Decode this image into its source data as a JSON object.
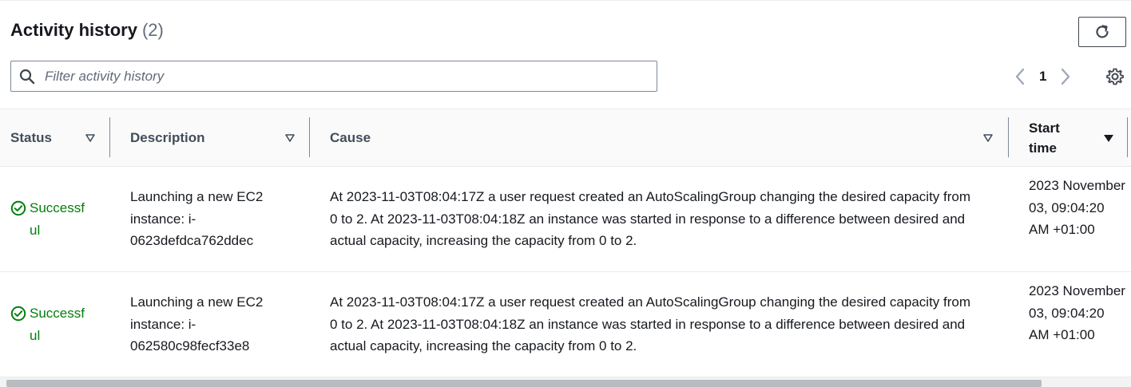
{
  "header": {
    "title": "Activity history",
    "count": "(2)",
    "refresh_icon": "refresh-icon"
  },
  "search": {
    "placeholder": "Filter activity history",
    "value": "",
    "icon": "search-icon"
  },
  "pagination": {
    "current_page": "1",
    "prev_icon": "chevron-left-icon",
    "next_icon": "chevron-right-icon",
    "settings_icon": "gear-icon"
  },
  "columns": {
    "status": "Status",
    "description": "Description",
    "cause": "Cause",
    "start_time": "Start time"
  },
  "rows": [
    {
      "status": "Successful",
      "description": "Launching a new EC2 instance: i-0623defdca762ddec",
      "cause": "At 2023-11-03T08:04:17Z a user request created an AutoScalingGroup changing the desired capacity from 0 to 2. At 2023-11-03T08:04:18Z an instance was started in response to a difference between desired and actual capacity, increasing the capacity from 0 to 2.",
      "start_time": "2023 November 03, 09:04:20 AM +01:00"
    },
    {
      "status": "Successful",
      "description": "Launching a new EC2 instance: i-062580c98fecf33e8",
      "cause": "At 2023-11-03T08:04:17Z a user request created an AutoScalingGroup changing the desired capacity from 0 to 2. At 2023-11-03T08:04:18Z an instance was started in response to a difference between desired and actual capacity, increasing the capacity from 0 to 2.",
      "start_time": "2023 November 03, 09:04:20 AM +01:00"
    }
  ],
  "colors": {
    "success": "#037f0c",
    "border": "#e9ebed",
    "header_bg": "#fafafa"
  }
}
